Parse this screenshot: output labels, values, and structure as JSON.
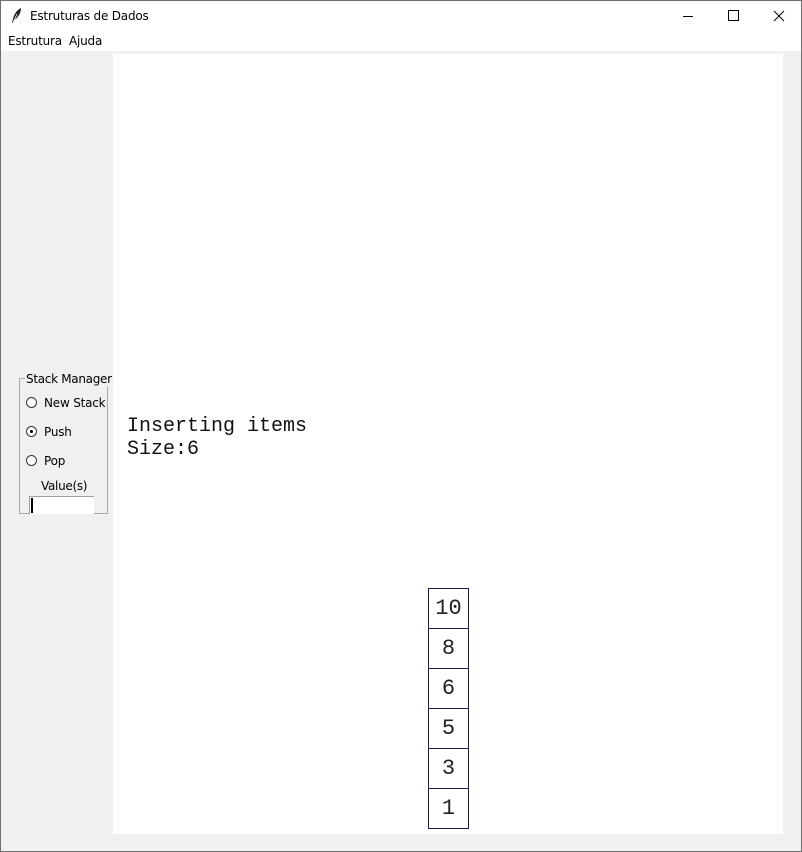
{
  "window": {
    "title": "Estruturas de Dados",
    "app_icon": "feather-icon"
  },
  "menubar": {
    "items": [
      "Estrutura",
      "Ajuda"
    ]
  },
  "stack_manager": {
    "title": "Stack Manager",
    "options": [
      {
        "label": "New Stack",
        "selected": false
      },
      {
        "label": "Push",
        "selected": true
      },
      {
        "label": "Pop",
        "selected": false
      }
    ],
    "value_label": "Value(s)",
    "value_input": ""
  },
  "canvas": {
    "status": "Inserting items",
    "size_text": "Size:6",
    "stack_items": [
      "10",
      "8",
      "6",
      "5",
      "3",
      "1"
    ]
  }
}
